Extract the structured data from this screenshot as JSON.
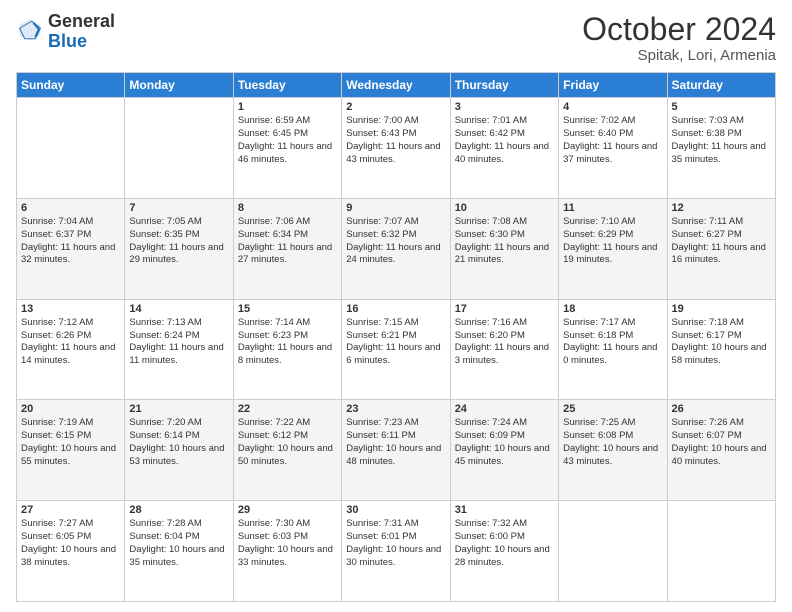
{
  "header": {
    "logo_general": "General",
    "logo_blue": "Blue",
    "month_title": "October 2024",
    "location": "Spitak, Lori, Armenia"
  },
  "days_of_week": [
    "Sunday",
    "Monday",
    "Tuesday",
    "Wednesday",
    "Thursday",
    "Friday",
    "Saturday"
  ],
  "weeks": [
    [
      {
        "day": "",
        "info": ""
      },
      {
        "day": "",
        "info": ""
      },
      {
        "day": "1",
        "info": "Sunrise: 6:59 AM\nSunset: 6:45 PM\nDaylight: 11 hours and 46 minutes."
      },
      {
        "day": "2",
        "info": "Sunrise: 7:00 AM\nSunset: 6:43 PM\nDaylight: 11 hours and 43 minutes."
      },
      {
        "day": "3",
        "info": "Sunrise: 7:01 AM\nSunset: 6:42 PM\nDaylight: 11 hours and 40 minutes."
      },
      {
        "day": "4",
        "info": "Sunrise: 7:02 AM\nSunset: 6:40 PM\nDaylight: 11 hours and 37 minutes."
      },
      {
        "day": "5",
        "info": "Sunrise: 7:03 AM\nSunset: 6:38 PM\nDaylight: 11 hours and 35 minutes."
      }
    ],
    [
      {
        "day": "6",
        "info": "Sunrise: 7:04 AM\nSunset: 6:37 PM\nDaylight: 11 hours and 32 minutes."
      },
      {
        "day": "7",
        "info": "Sunrise: 7:05 AM\nSunset: 6:35 PM\nDaylight: 11 hours and 29 minutes."
      },
      {
        "day": "8",
        "info": "Sunrise: 7:06 AM\nSunset: 6:34 PM\nDaylight: 11 hours and 27 minutes."
      },
      {
        "day": "9",
        "info": "Sunrise: 7:07 AM\nSunset: 6:32 PM\nDaylight: 11 hours and 24 minutes."
      },
      {
        "day": "10",
        "info": "Sunrise: 7:08 AM\nSunset: 6:30 PM\nDaylight: 11 hours and 21 minutes."
      },
      {
        "day": "11",
        "info": "Sunrise: 7:10 AM\nSunset: 6:29 PM\nDaylight: 11 hours and 19 minutes."
      },
      {
        "day": "12",
        "info": "Sunrise: 7:11 AM\nSunset: 6:27 PM\nDaylight: 11 hours and 16 minutes."
      }
    ],
    [
      {
        "day": "13",
        "info": "Sunrise: 7:12 AM\nSunset: 6:26 PM\nDaylight: 11 hours and 14 minutes."
      },
      {
        "day": "14",
        "info": "Sunrise: 7:13 AM\nSunset: 6:24 PM\nDaylight: 11 hours and 11 minutes."
      },
      {
        "day": "15",
        "info": "Sunrise: 7:14 AM\nSunset: 6:23 PM\nDaylight: 11 hours and 8 minutes."
      },
      {
        "day": "16",
        "info": "Sunrise: 7:15 AM\nSunset: 6:21 PM\nDaylight: 11 hours and 6 minutes."
      },
      {
        "day": "17",
        "info": "Sunrise: 7:16 AM\nSunset: 6:20 PM\nDaylight: 11 hours and 3 minutes."
      },
      {
        "day": "18",
        "info": "Sunrise: 7:17 AM\nSunset: 6:18 PM\nDaylight: 11 hours and 0 minutes."
      },
      {
        "day": "19",
        "info": "Sunrise: 7:18 AM\nSunset: 6:17 PM\nDaylight: 10 hours and 58 minutes."
      }
    ],
    [
      {
        "day": "20",
        "info": "Sunrise: 7:19 AM\nSunset: 6:15 PM\nDaylight: 10 hours and 55 minutes."
      },
      {
        "day": "21",
        "info": "Sunrise: 7:20 AM\nSunset: 6:14 PM\nDaylight: 10 hours and 53 minutes."
      },
      {
        "day": "22",
        "info": "Sunrise: 7:22 AM\nSunset: 6:12 PM\nDaylight: 10 hours and 50 minutes."
      },
      {
        "day": "23",
        "info": "Sunrise: 7:23 AM\nSunset: 6:11 PM\nDaylight: 10 hours and 48 minutes."
      },
      {
        "day": "24",
        "info": "Sunrise: 7:24 AM\nSunset: 6:09 PM\nDaylight: 10 hours and 45 minutes."
      },
      {
        "day": "25",
        "info": "Sunrise: 7:25 AM\nSunset: 6:08 PM\nDaylight: 10 hours and 43 minutes."
      },
      {
        "day": "26",
        "info": "Sunrise: 7:26 AM\nSunset: 6:07 PM\nDaylight: 10 hours and 40 minutes."
      }
    ],
    [
      {
        "day": "27",
        "info": "Sunrise: 7:27 AM\nSunset: 6:05 PM\nDaylight: 10 hours and 38 minutes."
      },
      {
        "day": "28",
        "info": "Sunrise: 7:28 AM\nSunset: 6:04 PM\nDaylight: 10 hours and 35 minutes."
      },
      {
        "day": "29",
        "info": "Sunrise: 7:30 AM\nSunset: 6:03 PM\nDaylight: 10 hours and 33 minutes."
      },
      {
        "day": "30",
        "info": "Sunrise: 7:31 AM\nSunset: 6:01 PM\nDaylight: 10 hours and 30 minutes."
      },
      {
        "day": "31",
        "info": "Sunrise: 7:32 AM\nSunset: 6:00 PM\nDaylight: 10 hours and 28 minutes."
      },
      {
        "day": "",
        "info": ""
      },
      {
        "day": "",
        "info": ""
      }
    ]
  ]
}
